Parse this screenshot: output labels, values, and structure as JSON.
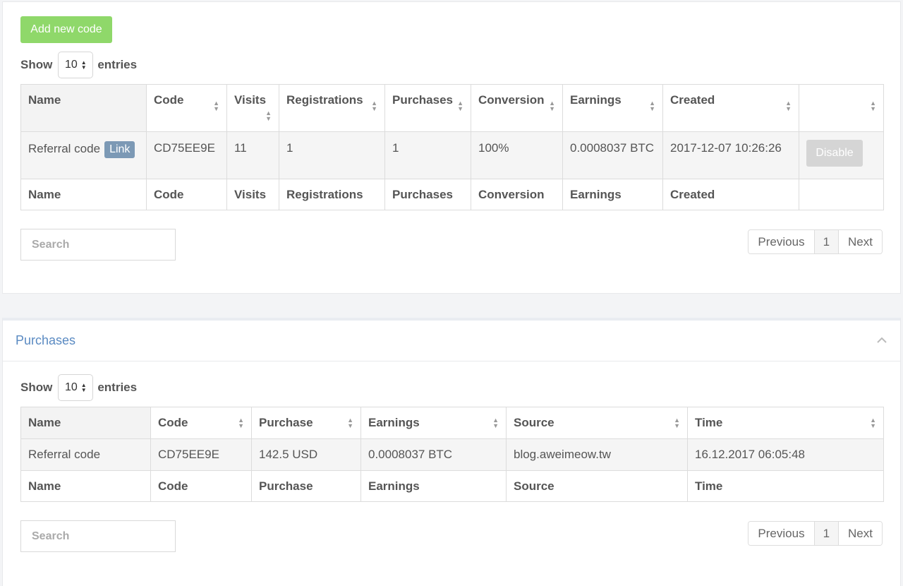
{
  "referral": {
    "add_button": "Add new code",
    "show_label": "Show",
    "entries_label": "entries",
    "page_length": "10",
    "columns": [
      "Name",
      "Code",
      "Visits",
      "Registrations",
      "Purchases",
      "Conversion",
      "Earnings",
      "Created",
      ""
    ],
    "row": {
      "name": "Referral code",
      "link_badge": "Link",
      "code": "CD75EE9E",
      "visits": "11",
      "registrations": "1",
      "purchases": "1",
      "conversion": "100%",
      "earnings": "0.0008037 BTC",
      "created": "2017-12-07 10:26:26",
      "action": "Disable"
    },
    "search_placeholder": "Search",
    "pager": {
      "previous": "Previous",
      "page": "1",
      "next": "Next"
    }
  },
  "purchases": {
    "title": "Purchases",
    "show_label": "Show",
    "entries_label": "entries",
    "page_length": "10",
    "columns": [
      "Name",
      "Code",
      "Purchase",
      "Earnings",
      "Source",
      "Time"
    ],
    "row": {
      "name": "Referral code",
      "code": "CD75EE9E",
      "purchase": "142.5 USD",
      "earnings": "0.0008037 BTC",
      "source": "blog.aweimeow.tw",
      "time": "16.12.2017 06:05:48"
    },
    "search_placeholder": "Search",
    "pager": {
      "previous": "Previous",
      "page": "1",
      "next": "Next"
    }
  },
  "icons": {
    "sort": "sort-both-icon",
    "collapse": "chevron-up-icon",
    "select_arrows": "select-arrows-icon"
  },
  "colors": {
    "add_button": "#8fd86a",
    "link_badge": "#7c99b5",
    "section_title": "#5a8ac2",
    "disabled_button": "#d5d5d5"
  }
}
